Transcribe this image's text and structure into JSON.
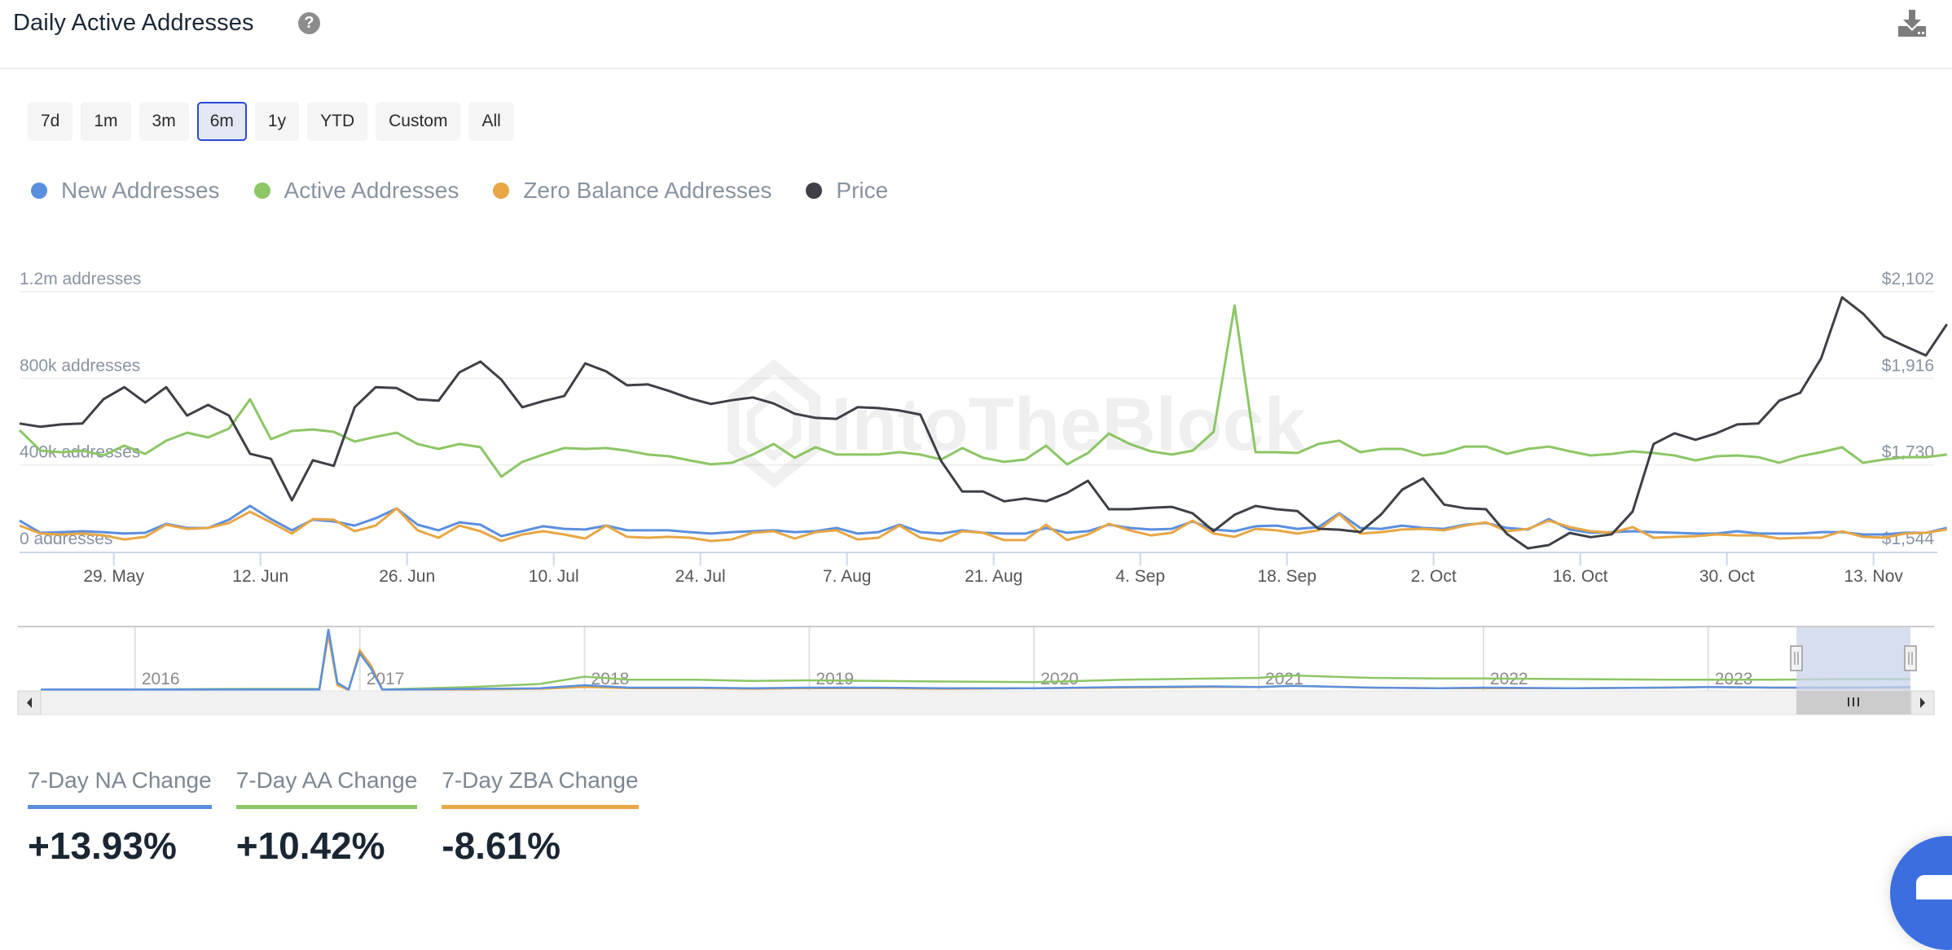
{
  "header": {
    "title": "Daily Active Addresses",
    "help_icon": "question-circle-icon",
    "download_icon": "download-icon"
  },
  "ranges": {
    "options": [
      "7d",
      "1m",
      "3m",
      "6m",
      "1y",
      "YTD",
      "Custom",
      "All"
    ],
    "selected": "6m"
  },
  "legend": [
    {
      "label": "New Addresses",
      "color": "#5b8fde"
    },
    {
      "label": "Active Addresses",
      "color": "#8cc665"
    },
    {
      "label": "Zero Balance Addresses",
      "color": "#e8a644"
    },
    {
      "label": "Price",
      "color": "#3d4046"
    }
  ],
  "watermark": "IntoTheBlock",
  "chart_data": {
    "type": "line",
    "title": "Daily Active Addresses",
    "start_date": "2023-05-20",
    "step_days": 2,
    "left_axis": {
      "unit": "thousand addresses",
      "range": [
        0,
        1200
      ],
      "ticks": [
        {
          "value": 0,
          "label": "0 addresses"
        },
        {
          "value": 400,
          "label": "400k addresses"
        },
        {
          "value": 800,
          "label": "800k addresses"
        },
        {
          "value": 1200,
          "label": "1.2m addresses"
        }
      ]
    },
    "right_axis": {
      "unit": "USD",
      "range": [
        1544,
        2102
      ],
      "ticks": [
        {
          "value": 1544,
          "label": "$1,544"
        },
        {
          "value": 1730,
          "label": "$1,730"
        },
        {
          "value": 1916,
          "label": "$1,916"
        },
        {
          "value": 2102,
          "label": "$2,102"
        }
      ]
    },
    "x_ticks": [
      {
        "day": 9,
        "label": "29. May"
      },
      {
        "day": 23,
        "label": "12. Jun"
      },
      {
        "day": 37,
        "label": "26. Jun"
      },
      {
        "day": 51,
        "label": "10. Jul"
      },
      {
        "day": 65,
        "label": "24. Jul"
      },
      {
        "day": 79,
        "label": "7. Aug"
      },
      {
        "day": 93,
        "label": "21. Aug"
      },
      {
        "day": 107,
        "label": "4. Sep"
      },
      {
        "day": 121,
        "label": "18. Sep"
      },
      {
        "day": 135,
        "label": "2. Oct"
      },
      {
        "day": 149,
        "label": "16. Oct"
      },
      {
        "day": 163,
        "label": "30. Oct"
      },
      {
        "day": 177,
        "label": "13. Nov"
      }
    ],
    "grid": true,
    "legend_position": "top-left",
    "series": [
      {
        "name": "Active Addresses",
        "axis": "left",
        "color": "#8cc665",
        "values": [
          561,
          466,
          459,
          466,
          444,
          489,
          451,
          512,
          549,
          527,
          568,
          703,
          519,
          557,
          564,
          553,
          508,
          530,
          549,
          497,
          474,
          497,
          482,
          346,
          414,
          448,
          478,
          474,
          478,
          466,
          448,
          440,
          421,
          403,
          410,
          448,
          497,
          433,
          482,
          448,
          448,
          448,
          459,
          448,
          425,
          478,
          433,
          414,
          425,
          489,
          403,
          455,
          545,
          497,
          463,
          448,
          466,
          553,
          1136,
          459,
          459,
          455,
          497,
          512,
          459,
          474,
          474,
          444,
          455,
          485,
          485,
          451,
          474,
          485,
          463,
          444,
          451,
          463,
          455,
          444,
          421,
          440,
          444,
          436,
          410,
          440,
          459,
          482,
          410,
          425,
          436,
          436,
          448
        ]
      },
      {
        "name": "New Addresses",
        "axis": "left",
        "color": "#5b8fde",
        "values": [
          143,
          87,
          90,
          94,
          90,
          83,
          87,
          128,
          109,
          109,
          147,
          211,
          150,
          98,
          147,
          139,
          120,
          154,
          199,
          124,
          98,
          135,
          124,
          71,
          94,
          117,
          105,
          102,
          120,
          98,
          98,
          98,
          90,
          83,
          90,
          94,
          98,
          90,
          94,
          109,
          83,
          90,
          124,
          90,
          83,
          98,
          87,
          83,
          83,
          109,
          87,
          94,
          124,
          109,
          102,
          105,
          139,
          102,
          94,
          117,
          120,
          105,
          113,
          177,
          109,
          105,
          120,
          109,
          105,
          124,
          132,
          109,
          102,
          150,
          102,
          87,
          90,
          94,
          90,
          87,
          83,
          83,
          94,
          83,
          83,
          83,
          90,
          90,
          79,
          79,
          87,
          87,
          109
        ]
      },
      {
        "name": "Zero Balance Addresses",
        "axis": "left",
        "color": "#e8a644",
        "values": [
          120,
          83,
          79,
          83,
          75,
          56,
          68,
          124,
          105,
          109,
          132,
          184,
          135,
          83,
          150,
          147,
          94,
          120,
          199,
          98,
          64,
          120,
          94,
          49,
          79,
          94,
          79,
          60,
          120,
          68,
          64,
          68,
          64,
          49,
          56,
          87,
          94,
          60,
          90,
          98,
          56,
          64,
          120,
          64,
          49,
          94,
          87,
          53,
          53,
          124,
          53,
          79,
          128,
          98,
          75,
          87,
          143,
          83,
          68,
          105,
          98,
          83,
          98,
          173,
          83,
          90,
          102,
          105,
          98,
          120,
          135,
          94,
          105,
          143,
          113,
          94,
          87,
          113,
          64,
          68,
          71,
          79,
          75,
          75,
          60,
          64,
          64,
          94,
          68,
          64,
          83,
          87,
          102
        ]
      },
      {
        "name": "Price",
        "axis": "right",
        "color": "#3d4046",
        "values": [
          1819,
          1812,
          1817,
          1819,
          1871,
          1897,
          1864,
          1897,
          1836,
          1859,
          1836,
          1754,
          1743,
          1654,
          1740,
          1728,
          1854,
          1897,
          1895,
          1871,
          1868,
          1929,
          1952,
          1913,
          1854,
          1867,
          1878,
          1948,
          1931,
          1901,
          1903,
          1889,
          1873,
          1861,
          1869,
          1875,
          1862,
          1840,
          1831,
          1829,
          1854,
          1852,
          1847,
          1838,
          1738,
          1673,
          1673,
          1652,
          1658,
          1652,
          1670,
          1696,
          1635,
          1635,
          1638,
          1640,
          1626,
          1588,
          1623,
          1642,
          1635,
          1631,
          1593,
          1591,
          1586,
          1624,
          1677,
          1701,
          1645,
          1637,
          1635,
          1582,
          1551,
          1558,
          1584,
          1575,
          1581,
          1630,
          1775,
          1798,
          1784,
          1798,
          1817,
          1819,
          1868,
          1885,
          1959,
          2090,
          2055,
          2006,
          1985,
          1965,
          2032
        ]
      }
    ]
  },
  "navigator": {
    "years": [
      "2016",
      "2017",
      "2018",
      "2019",
      "2020",
      "2021",
      "2022",
      "2023"
    ],
    "range_start_year": 2015.58,
    "range_end_year": 2023.9,
    "selection": {
      "from": "2023-05-20",
      "to": "2023-11-20"
    },
    "scroll_thumb_icon": "grip-lines-icon",
    "scroll_left_icon": "caret-left-icon",
    "scroll_right_icon": "caret-right-icon",
    "series_relative": {
      "years": [
        2015.58,
        2016.0,
        2016.5,
        2016.82,
        2016.86,
        2016.9,
        2016.95,
        2017.0,
        2017.05,
        2017.1,
        2017.2,
        2017.5,
        2017.8,
        2018.0,
        2018.2,
        2018.5,
        2018.75,
        2019.0,
        2019.3,
        2019.6,
        2020.0,
        2020.4,
        2020.8,
        2021.0,
        2021.15,
        2021.5,
        2021.8,
        2022.0,
        2022.4,
        2022.8,
        2023.0,
        2023.3,
        2023.6,
        2023.9
      ],
      "active": [
        0.01,
        0.01,
        0.02,
        0.02,
        0.98,
        0.1,
        0.01,
        0.65,
        0.4,
        0.01,
        0.02,
        0.05,
        0.1,
        0.22,
        0.17,
        0.17,
        0.15,
        0.16,
        0.15,
        0.14,
        0.13,
        0.17,
        0.19,
        0.2,
        0.24,
        0.2,
        0.19,
        0.19,
        0.18,
        0.17,
        0.17,
        0.17,
        0.18,
        0.18
      ],
      "new": [
        0.01,
        0.01,
        0.01,
        0.01,
        1.0,
        0.12,
        0.01,
        0.6,
        0.35,
        0.01,
        0.01,
        0.02,
        0.03,
        0.08,
        0.04,
        0.04,
        0.03,
        0.04,
        0.04,
        0.03,
        0.03,
        0.05,
        0.06,
        0.05,
        0.07,
        0.04,
        0.03,
        0.04,
        0.03,
        0.04,
        0.05,
        0.04,
        0.04,
        0.05
      ],
      "zba": [
        0.0,
        0.0,
        0.0,
        0.0,
        0.9,
        0.08,
        0.0,
        0.65,
        0.4,
        0.0,
        0.0,
        0.01,
        0.02,
        0.05,
        0.03,
        0.03,
        0.02,
        0.03,
        0.03,
        0.02,
        0.03,
        0.04,
        0.05,
        0.05,
        0.07,
        0.04,
        0.03,
        0.03,
        0.03,
        0.04,
        0.05,
        0.04,
        0.04,
        0.04
      ]
    }
  },
  "stats": [
    {
      "label": "7-Day NA Change",
      "value": "+13.93%",
      "color": "#5b8fde"
    },
    {
      "label": "7-Day AA Change",
      "value": "+10.42%",
      "color": "#8cc665"
    },
    {
      "label": "7-Day ZBA Change",
      "value": "-8.61%",
      "color": "#e8a644"
    }
  ],
  "chat_widget_icon": "chat-icon"
}
